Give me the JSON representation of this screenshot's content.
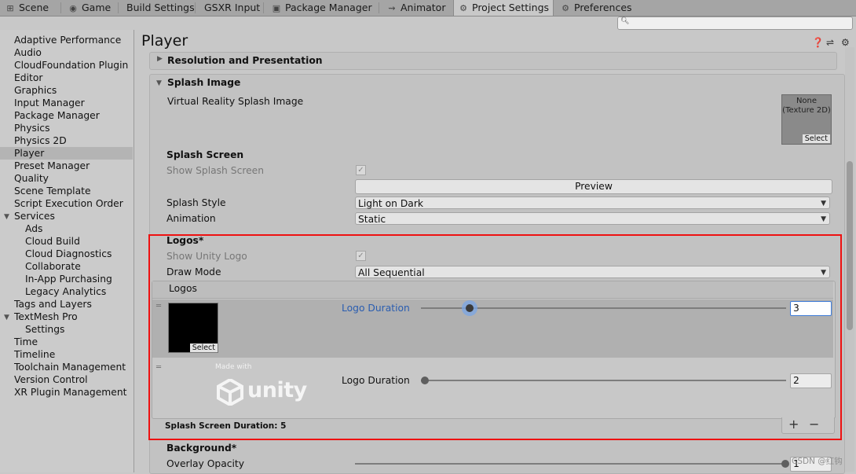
{
  "tabs": [
    {
      "label": "Scene",
      "icon": "scene-icon"
    },
    {
      "label": "Game",
      "icon": "game-icon"
    },
    {
      "label": "Build Settings"
    },
    {
      "label": "GSXR Input"
    },
    {
      "label": "Package Manager",
      "icon": "package-icon"
    },
    {
      "label": "Animator",
      "icon": "animator-icon"
    },
    {
      "label": "Project Settings",
      "icon": "gear-icon",
      "active": true
    },
    {
      "label": "Preferences",
      "icon": "gear-icon"
    }
  ],
  "search": {
    "placeholder": ""
  },
  "sidebar": {
    "items": [
      {
        "label": "Adaptive Performance"
      },
      {
        "label": "Audio"
      },
      {
        "label": "CloudFoundation Plugin"
      },
      {
        "label": "Editor"
      },
      {
        "label": "Graphics"
      },
      {
        "label": "Input Manager"
      },
      {
        "label": "Package Manager"
      },
      {
        "label": "Physics"
      },
      {
        "label": "Physics 2D"
      },
      {
        "label": "Player",
        "selected": true
      },
      {
        "label": "Preset Manager"
      },
      {
        "label": "Quality"
      },
      {
        "label": "Scene Template"
      },
      {
        "label": "Script Execution Order"
      },
      {
        "label": "Services",
        "expanded": true
      },
      {
        "label": "Ads",
        "child": true
      },
      {
        "label": "Cloud Build",
        "child": true
      },
      {
        "label": "Cloud Diagnostics",
        "child": true
      },
      {
        "label": "Collaborate",
        "child": true
      },
      {
        "label": "In-App Purchasing",
        "child": true
      },
      {
        "label": "Legacy Analytics",
        "child": true
      },
      {
        "label": "Tags and Layers"
      },
      {
        "label": "TextMesh Pro",
        "expanded": true
      },
      {
        "label": "Settings",
        "child": true
      },
      {
        "label": "Time"
      },
      {
        "label": "Timeline"
      },
      {
        "label": "Toolchain Management"
      },
      {
        "label": "Version Control"
      },
      {
        "label": "XR Plugin Management"
      }
    ]
  },
  "main": {
    "title": "Player",
    "resolution_section": "Resolution and Presentation",
    "splash_section": "Splash Image",
    "vr_splash_label": "Virtual Reality Splash Image",
    "texture_slot": {
      "value": "None\n(Texture 2D)",
      "select": "Select"
    },
    "splash_screen_header": "Splash Screen",
    "show_splash_label": "Show Splash Screen",
    "preview_button": "Preview",
    "splash_style_label": "Splash Style",
    "splash_style_value": "Light on Dark",
    "animation_label": "Animation",
    "animation_value": "Static",
    "logos_header": "Logos*",
    "show_unity_logo_label": "Show Unity Logo",
    "draw_mode_label": "Draw Mode",
    "draw_mode_value": "All Sequential",
    "logos_list_header": "Logos",
    "logo_rows": [
      {
        "duration_label": "Logo Duration",
        "duration": "3",
        "duration_fraction": 0.21,
        "select": "Select"
      },
      {
        "duration_label": "Logo Duration",
        "duration": "2",
        "duration_fraction": 0.0,
        "logo_caption": "Made with",
        "logo_word": "unity"
      }
    ],
    "splash_duration": "Splash Screen Duration: 5",
    "add_label": "+",
    "remove_label": "−",
    "background_header": "Background*",
    "overlay_opacity_label": "Overlay Opacity",
    "overlay_opacity_value": "1",
    "watermark": "CSDN @红钩"
  },
  "colors": {
    "accent": "#2a5db0",
    "highlight_box": "#ee1111",
    "selected_row": "#b4b4b4"
  }
}
